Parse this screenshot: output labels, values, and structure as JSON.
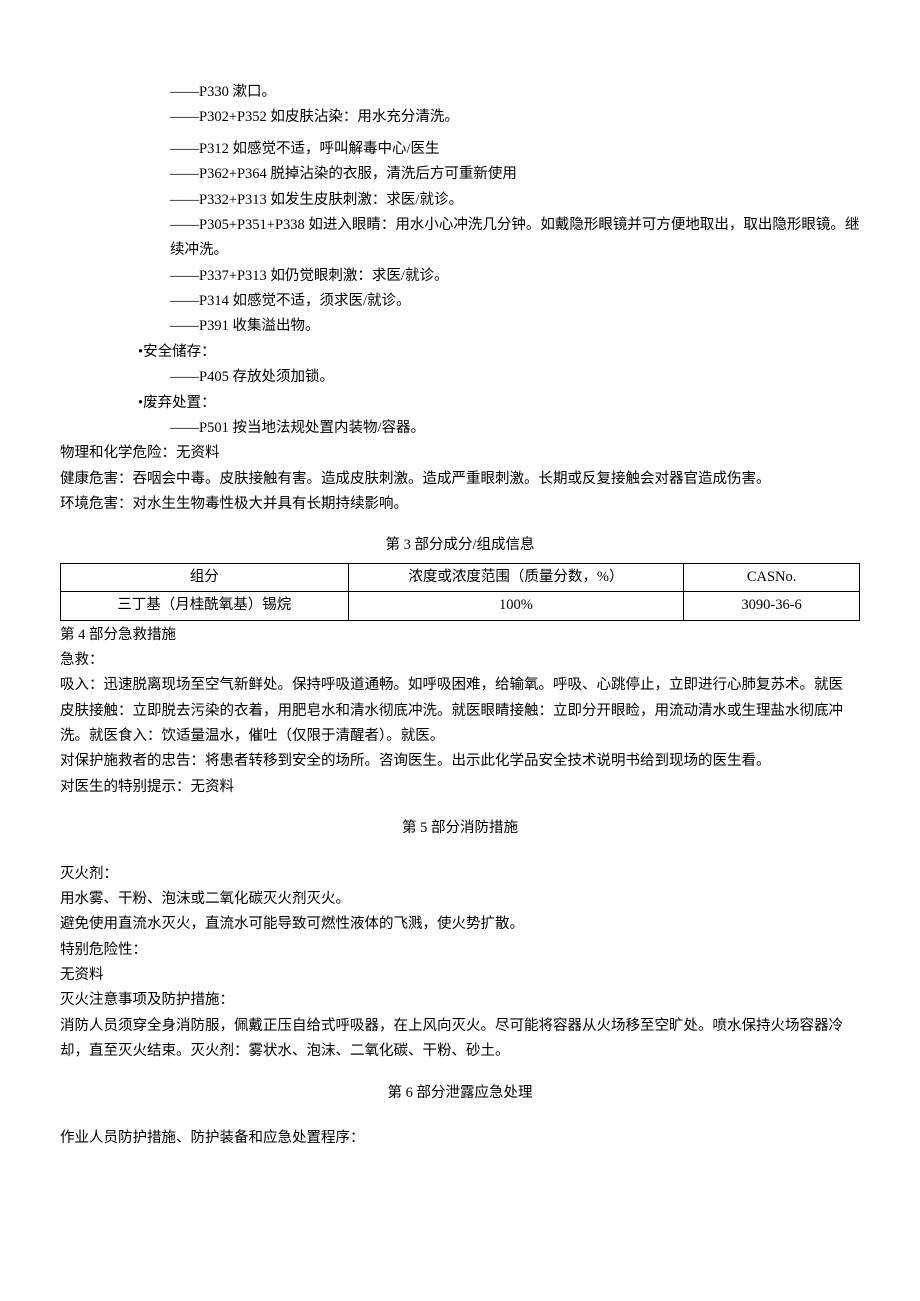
{
  "p_statements": [
    "——P330 漱口。",
    "——P302+P352 如皮肤沾染：用水充分清洗。",
    "——P312 如感觉不适，呼叫解毒中心/医生",
    "——P362+P364 脱掉沾染的衣服，清洗后方可重新使用",
    "——P332+P313 如发生皮肤刺激：求医/就诊。",
    "——P305+P351+P338 如进入眼睛：用水小心冲洗几分钟。如戴隐形眼镜并可方便地取出，取出隐形眼镜。继续冲洗。",
    "——P337+P313 如仍觉眼刺激：求医/就诊。",
    "——P314 如感觉不适，须求医/就诊。",
    "——P391 收集溢出物。"
  ],
  "storage_label": "•安全储存：",
  "storage_item": "——P405 存放处须加锁。",
  "disposal_label": "•废弃处置：",
  "disposal_item": "——P501 按当地法规处置内装物/容器。",
  "phys": "物理和化学危险：无资料",
  "health": "健康危害：吞咽会中毒。皮肤接触有害。造成皮肤刺激。造成严重眼刺激。长期或反复接触会对器官造成伤害。",
  "env": "环境危害：对水生生物毒性极大并具有长期持续影响。",
  "section3_title": "第 3 部分成分/组成信息",
  "table": {
    "h1": "组分",
    "h2": "浓度或浓度范围（质量分数，%）",
    "h3": "CASNo.",
    "r1": "三丁基（月桂酰氧基）锡烷",
    "r2": "100%",
    "r3": "3090-36-6"
  },
  "section4_title": "第 4 部分急救措施",
  "first_aid_label": "急救：",
  "inhale": "吸入：迅速脱离现场至空气新鲜处。保持呼吸道通畅。如呼吸困难，给输氧。呼吸、心跳停止，立即进行心肺复苏术。就医",
  "skin_eye": "皮肤接触：立即脱去污染的衣着，用肥皂水和清水彻底冲洗。就医眼睛接触：立即分开眼睑，用流动清水或生理盐水彻底冲洗。就医食入：饮适量温水，催吐（仅限于清醒者）。就医。",
  "rescuer": "对保护施救者的忠告：将患者转移到安全的场所。咨询医生。出示此化学品安全技术说明书给到现场的医生看。",
  "doctor": "对医生的特别提示：无资料",
  "section5_title": "第 5 部分消防措施",
  "ext_label": "灭火剂：",
  "ext1": "用水雾、干粉、泡沫或二氧化碳灭火剂灭火。",
  "ext2": "避免使用直流水灭火，直流水可能导致可燃性液体的飞溅，使火势扩散。",
  "danger_label": "特别危险性：",
  "danger_val": "无资料",
  "fire_note_label": "灭火注意事项及防护措施：",
  "fire_note": "消防人员须穿全身消防服，佩戴正压自给式呼吸器，在上风向灭火。尽可能将容器从火场移至空旷处。喷水保持火场容器冷却，直至灭火结束。灭火剂：雾状水、泡沫、二氧化碳、干粉、砂土。",
  "section6_title": "第 6 部分泄露应急处理",
  "personnel": "作业人员防护措施、防护装备和应急处置程序："
}
